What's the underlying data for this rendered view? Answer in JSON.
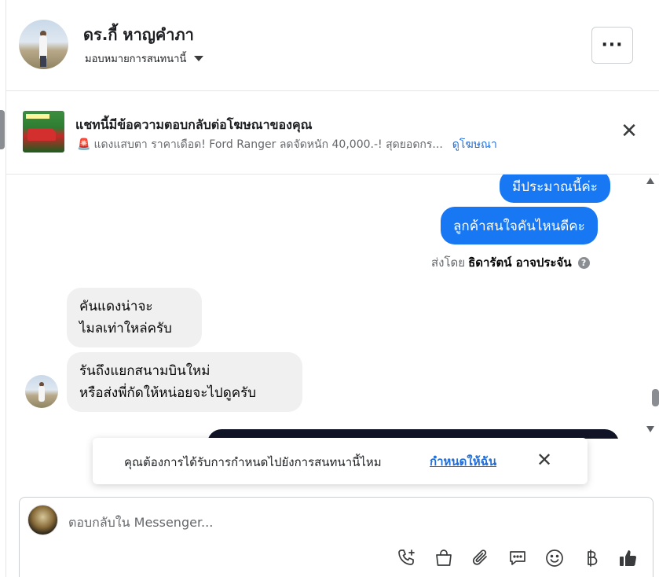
{
  "header": {
    "contact_name": "ดร.กี้ หาญคำภา",
    "assign_label": "มอบหมายการสนทนานี้",
    "more_label": "···"
  },
  "ad_banner": {
    "title": "แชทนี้มีข้อความตอบกลับต่อโฆษณาของคุณ",
    "ad_text": "แดงแสบตา ราคาเดือด! Ford Ranger ลดจัดหนัก 40,000.-! สุดยอดกร...",
    "link": "ดูโฆษณา",
    "close": "✕"
  },
  "messages": {
    "out_1": "มีประมาณนี้ค่ะ",
    "out_2": "ลูกค้าสนใจคันไหนดีคะ",
    "sent_by_prefix": "ส่งโดย",
    "sent_by_name": "ธิดารัตน์ อาจประจัน",
    "help": "?",
    "in_1_line1": "คันแดงน่าจะ",
    "in_1_line2": "ไมลเท่าใหล่ครับ",
    "in_2_line1": "รันถึงแยกสนามบินใหม่",
    "in_2_line2": "หรือส่งพี่กัดให้หน่อยจะไปดูครับ"
  },
  "toast": {
    "text": "คุณต้องการได้รับการกำหนดไปยังการสนทนานี้ไหม",
    "link": "กำหนดให้ฉัน",
    "close": "✕"
  },
  "composer": {
    "placeholder": "ตอบกลับใน Messenger...",
    "tools": [
      "phone-plus-icon",
      "shopping-bag-icon",
      "paperclip-icon",
      "chat-bubble-icon",
      "emoji-icon",
      "baht-icon",
      "thumbs-up-icon"
    ]
  },
  "colors": {
    "accent": "#1877f2",
    "link": "#216fdb",
    "bubble_in": "#f0f0f0"
  }
}
